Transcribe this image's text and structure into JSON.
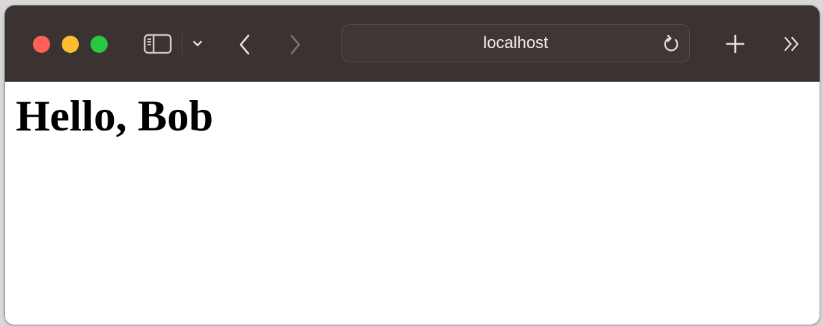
{
  "toolbar": {
    "icons": {
      "sidebar": "sidebar-icon",
      "tab_overview": "chevron-down-icon",
      "back": "chevron-left-icon",
      "forward": "chevron-right-icon",
      "reload": "reload-icon",
      "new_tab": "plus-icon",
      "more": "double-chevron-right-icon"
    },
    "address_bar": {
      "value": "localhost"
    }
  },
  "page": {
    "heading": "Hello, Bob"
  },
  "colors": {
    "toolbar_bg": "#3b3331",
    "close": "#fe5f57",
    "minimize": "#febc2e",
    "maximize": "#28c840"
  }
}
